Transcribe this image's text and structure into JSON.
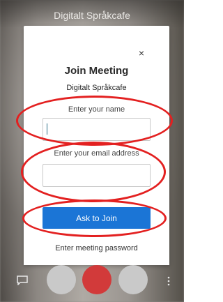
{
  "meeting": {
    "title": "Digitalt Språkcafe"
  },
  "dialog": {
    "close_glyph": "×",
    "heading": "Join Meeting",
    "meeting_name": "Digitalt Språkcafe",
    "name_label": "Enter your name",
    "name_value": "",
    "email_label": "Enter your email address",
    "email_value": "",
    "join_button": "Ask to Join",
    "password_link": "Enter meeting password"
  },
  "colors": {
    "primary_button": "#1b75d6",
    "annotation_ring": "#e32020",
    "hangup_button": "#d23a3a"
  },
  "toolbar": {
    "icons": [
      "chat-icon",
      "microphone-icon",
      "hangup-icon",
      "video-icon",
      "more-options-icon"
    ]
  }
}
